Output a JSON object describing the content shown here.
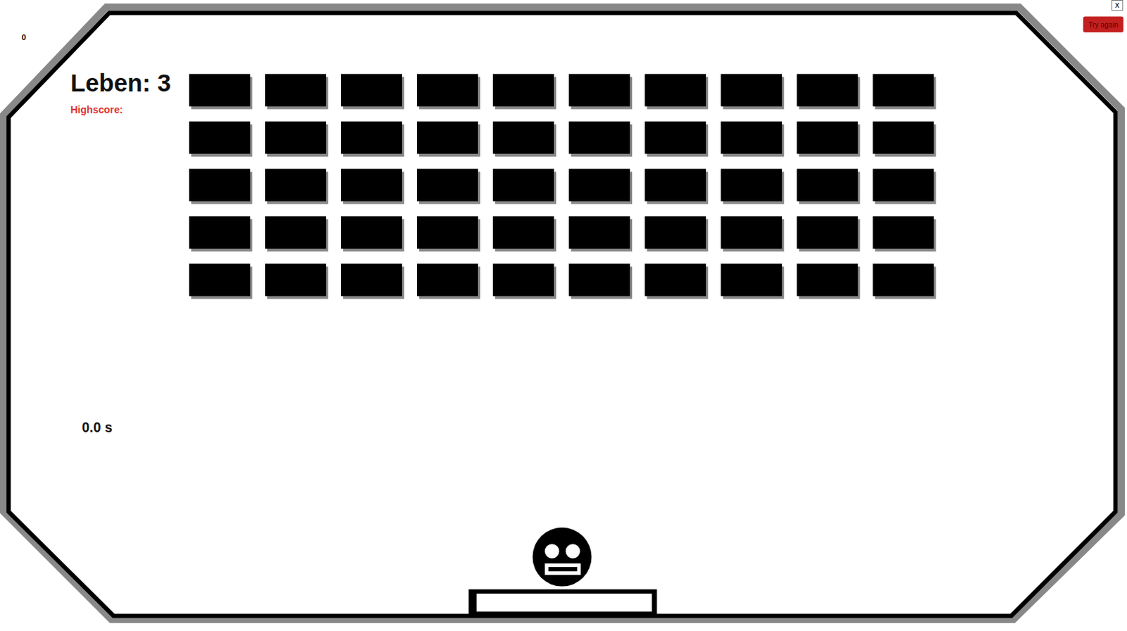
{
  "score": "0",
  "lives": "Leben: 3",
  "highscore": "Highscore:",
  "timer": "0.0 s",
  "buttons": {
    "close": "x",
    "try_again": "Try again"
  },
  "brick_rows": [
    {
      "bricks": [
        {
          "intact": true
        },
        {
          "intact": true
        },
        {
          "intact": true
        },
        {
          "intact": true
        },
        {
          "intact": true
        },
        {
          "intact": true
        },
        {
          "intact": true
        },
        {
          "intact": true
        },
        {
          "intact": true
        },
        {
          "intact": true
        }
      ]
    },
    {
      "bricks": [
        {
          "intact": true
        },
        {
          "intact": true
        },
        {
          "intact": true
        },
        {
          "intact": true
        },
        {
          "intact": true
        },
        {
          "intact": true
        },
        {
          "intact": true
        },
        {
          "intact": true
        },
        {
          "intact": true
        },
        {
          "intact": true
        }
      ]
    },
    {
      "bricks": [
        {
          "intact": true
        },
        {
          "intact": true
        },
        {
          "intact": true
        },
        {
          "intact": true
        },
        {
          "intact": true
        },
        {
          "intact": true
        },
        {
          "intact": true
        },
        {
          "intact": true
        },
        {
          "intact": true
        },
        {
          "intact": true
        }
      ]
    },
    {
      "bricks": [
        {
          "intact": true
        },
        {
          "intact": true
        },
        {
          "intact": true
        },
        {
          "intact": true
        },
        {
          "intact": true
        },
        {
          "intact": true
        },
        {
          "intact": true
        },
        {
          "intact": true
        },
        {
          "intact": true
        },
        {
          "intact": true
        }
      ]
    },
    {
      "bricks": [
        {
          "intact": true
        },
        {
          "intact": true
        },
        {
          "intact": true
        },
        {
          "intact": true
        },
        {
          "intact": true
        },
        {
          "intact": true
        },
        {
          "intact": true
        },
        {
          "intact": true
        },
        {
          "intact": true
        },
        {
          "intact": true
        }
      ]
    }
  ]
}
